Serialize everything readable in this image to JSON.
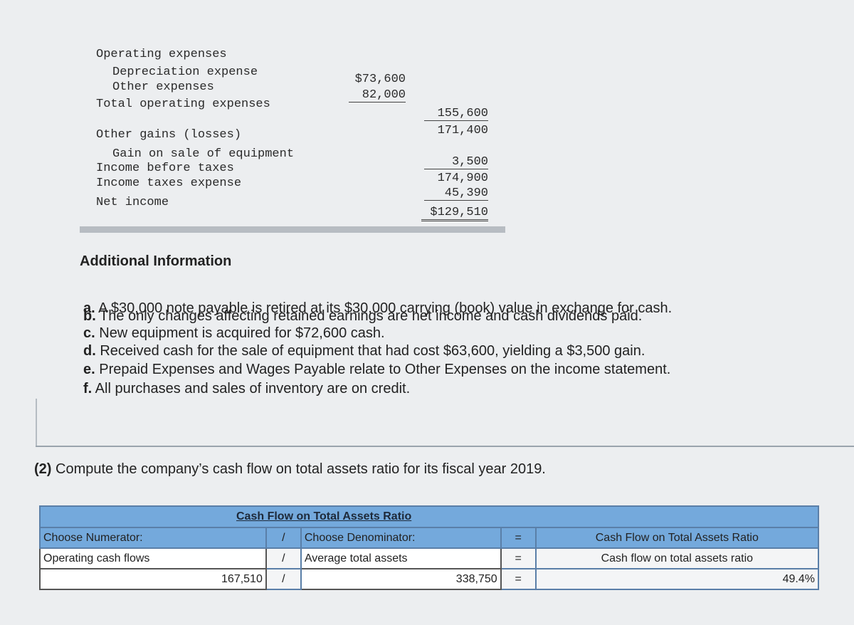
{
  "income_statement": {
    "operating_expenses_label": "Operating expenses",
    "depreciation_label": "Depreciation expense",
    "depreciation_value": "$73,600",
    "other_expenses_label": "Other expenses",
    "other_expenses_value": "82,000",
    "total_operating_label": "Total operating expenses",
    "total_operating_value": "155,600",
    "subtotal_value": "171,400",
    "other_gains_label": "Other gains (losses)",
    "gain_label": "Gain on sale of equipment",
    "gain_value": "3,500",
    "income_before_taxes_label": "Income before taxes",
    "income_before_taxes_value": "174,900",
    "income_taxes_label": "Income taxes expense",
    "income_taxes_value": "45,390",
    "net_income_label": "Net income",
    "net_income_value": "$129,510"
  },
  "additional_info": {
    "title": "Additional Information",
    "items": [
      {
        "letter": "a.",
        "text": " A $30,000 note payable is retired at its $30,000 carrying (book) value in exchange for cash."
      },
      {
        "letter": "b.",
        "text": " The only changes affecting retained earnings are net income and cash dividends paid."
      },
      {
        "letter": "c.",
        "text": " New equipment is acquired for $72,600 cash."
      },
      {
        "letter": "d.",
        "text": " Received cash for the sale of equipment that had cost $63,600, yielding a $3,500 gain."
      },
      {
        "letter": "e.",
        "text": " Prepaid Expenses and Wages Payable relate to Other Expenses on the income statement."
      },
      {
        "letter": "f.",
        "text": " All purchases and sales of inventory are on credit."
      }
    ]
  },
  "question": {
    "number": "(2)",
    "text": " Compute the company’s cash flow on total assets ratio for its fiscal year 2019."
  },
  "ratio_table": {
    "title": "Cash Flow on Total Assets Ratio",
    "numerator_header": "Choose Numerator:",
    "slash": "/",
    "denominator_header": "Choose Denominator:",
    "equals": "=",
    "result_header": "Cash Flow on Total Assets Ratio",
    "numerator_label": "Operating cash flows",
    "denominator_label": "Average total assets",
    "result_label": "Cash flow on total assets ratio",
    "numerator_value": "167,510",
    "denominator_value": "338,750",
    "result_value": "49.4%"
  }
}
